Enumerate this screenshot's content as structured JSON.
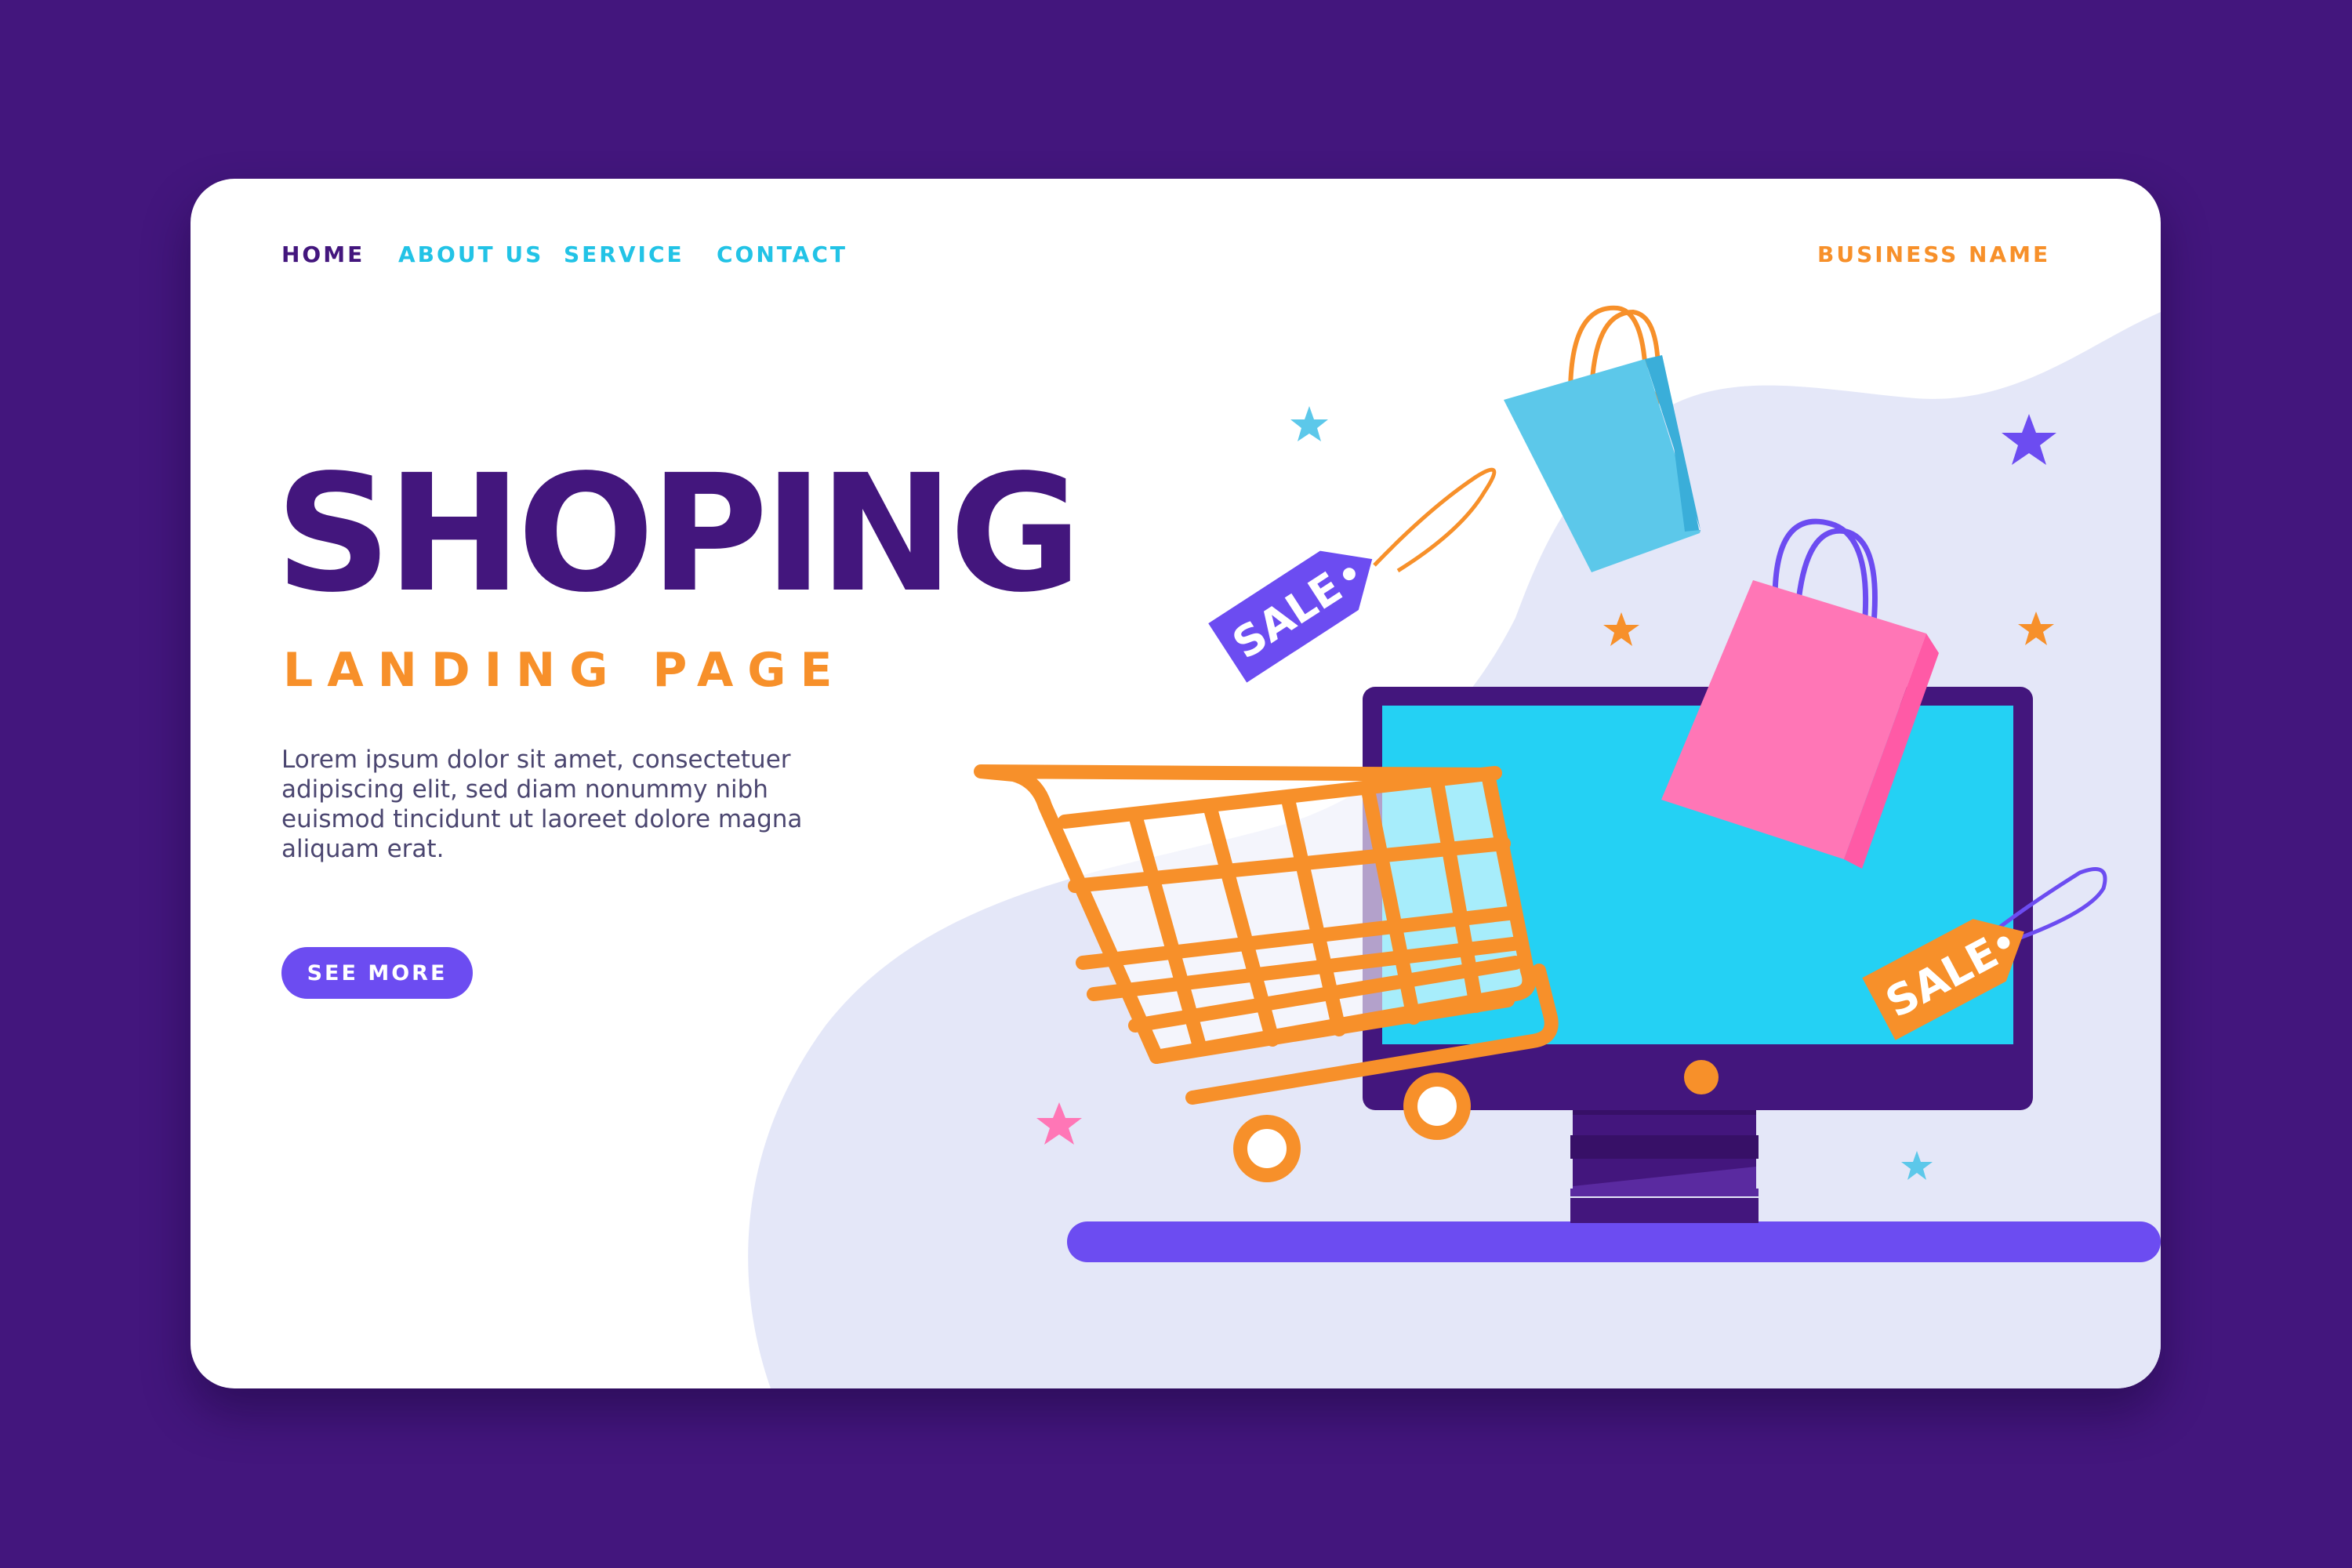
{
  "nav": {
    "items": [
      {
        "label": "HOME",
        "active": true
      },
      {
        "label": "ABOUT US",
        "active": false
      },
      {
        "label": "SERVICE",
        "active": false
      },
      {
        "label": "CONTACT",
        "active": false
      }
    ],
    "brand": "BUSINESS NAME"
  },
  "hero": {
    "title": "SHOPING",
    "subtitle": "LANDING PAGE",
    "body": "Lorem ipsum dolor sit amet, consectetuer adipiscing elit, sed diam nonummy nibh euismod tincidunt ut laoreet dolore magna aliquam erat.",
    "cta_label": "SEE MORE"
  },
  "illustration": {
    "tag_left_text": "SALE",
    "tag_right_text": "SALE"
  },
  "colors": {
    "background": "#43167d",
    "card": "#ffffff",
    "blob": "#e4e7f8",
    "primary_dark": "#43167d",
    "nav_link": "#22c3e6",
    "accent_orange": "#f7902a",
    "accent_purple": "#6c4cf1",
    "screen_blue": "#24d1f4",
    "bag_blue": "#5cc8ea",
    "bag_pink": "#ff76b6"
  },
  "icons": [
    "shopping-cart-icon",
    "shopping-bag-icon",
    "sale-tag-icon",
    "computer-monitor-icon",
    "star-icon"
  ]
}
